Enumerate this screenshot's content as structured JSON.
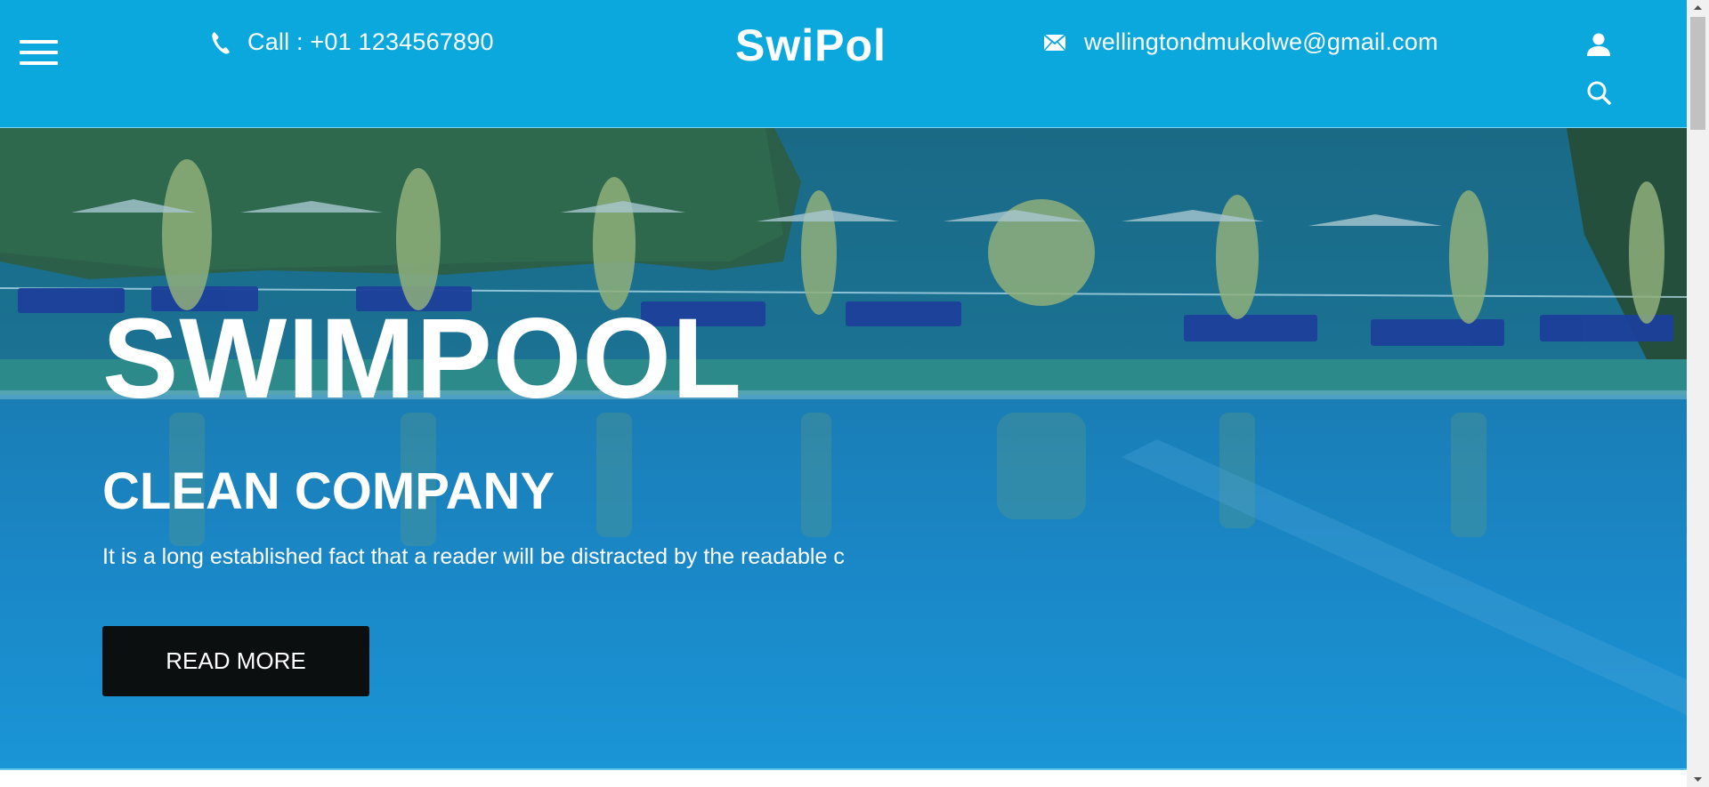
{
  "header": {
    "call_text": "Call : +01 1234567890",
    "logo": "SwiPol",
    "email": "wellingtondmukolwe@gmail.com",
    "icons": {
      "menu": "hamburger-menu-icon",
      "phone": "phone-icon",
      "mail": "mail-icon",
      "user": "user-icon",
      "search": "search-icon"
    }
  },
  "hero": {
    "title": "SWIMPOOL",
    "subtitle": "CLEAN COMPANY",
    "text": "It is a long established fact that a reader will be distracted by the readable c",
    "button_label": "READ MORE"
  },
  "colors": {
    "header_bg": "#0aa8dc",
    "button_bg": "#0b0f10",
    "text": "#ffffff"
  }
}
